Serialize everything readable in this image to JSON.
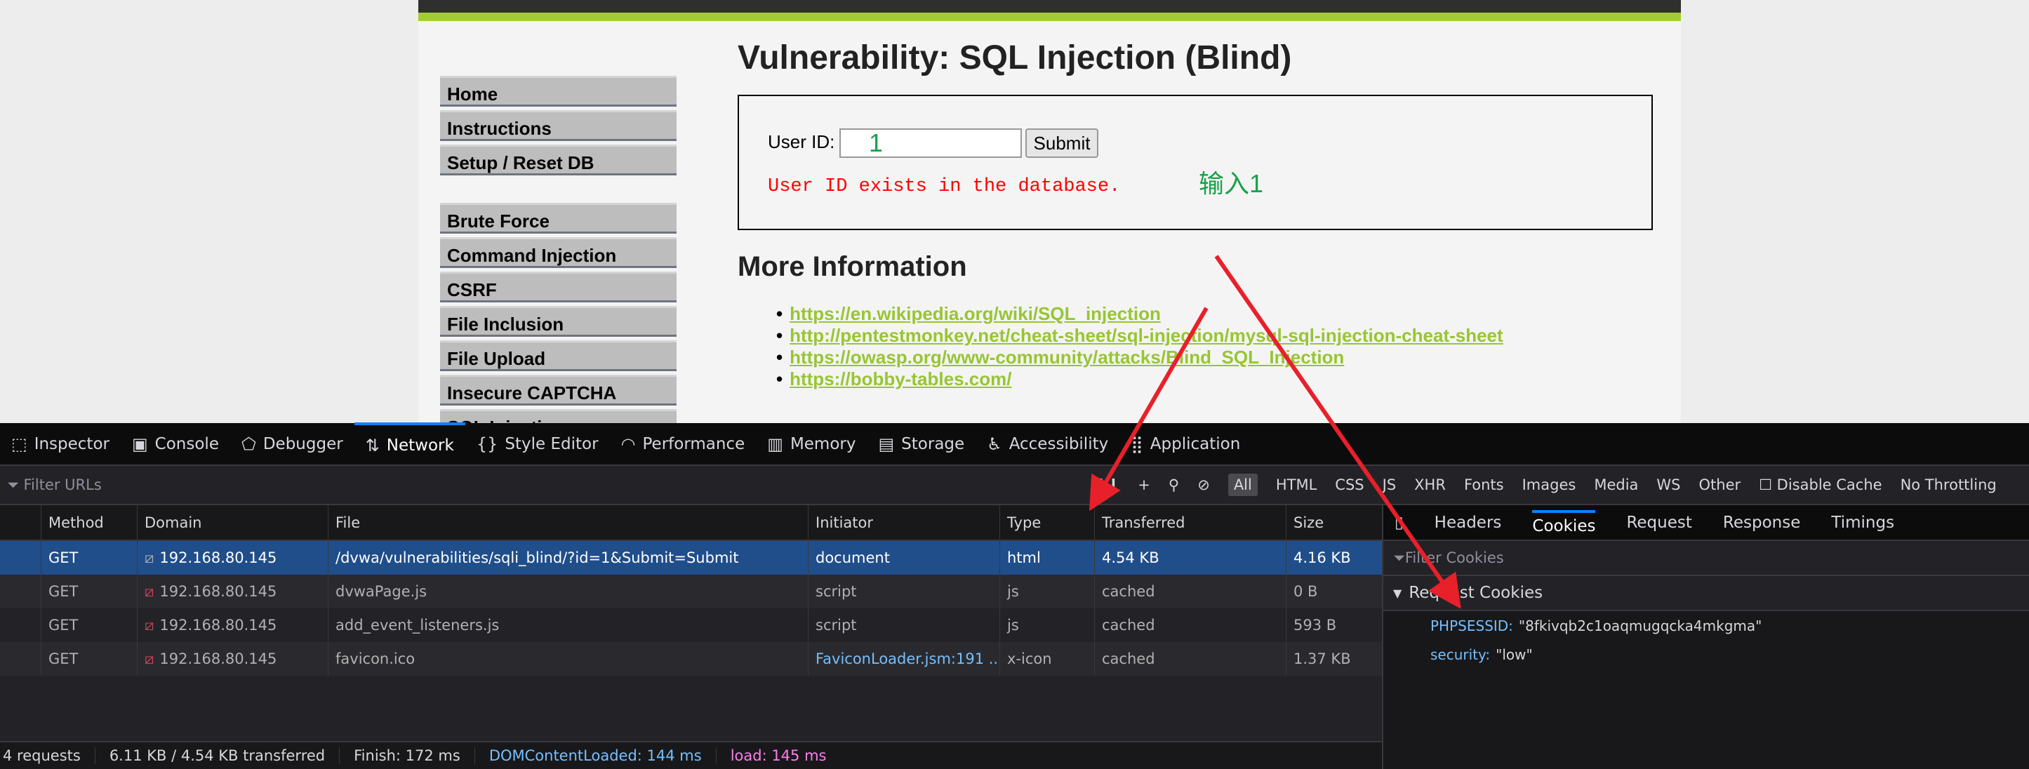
{
  "page": {
    "menu": [
      "Home",
      "Instructions",
      "Setup / Reset DB",
      "Brute Force",
      "Command Injection",
      "CSRF",
      "File Inclusion",
      "File Upload",
      "Insecure CAPTCHA",
      "SQL Injection"
    ],
    "title": "Vulnerability: SQL Injection (Blind)",
    "form": {
      "label": "User ID:",
      "value": "1",
      "submit": "Submit"
    },
    "message": "User ID exists in the database.",
    "annotation": "输入1",
    "more_title": "More Information",
    "links": [
      "https://en.wikipedia.org/wiki/SQL_injection",
      "http://pentestmonkey.net/cheat-sheet/sql-injection/mysql-sql-injection-cheat-sheet",
      "https://owasp.org/www-community/attacks/Blind_SQL_Injection",
      "https://bobby-tables.com/"
    ]
  },
  "devtools": {
    "tabs": [
      "Inspector",
      "Console",
      "Debugger",
      "Network",
      "Style Editor",
      "Performance",
      "Memory",
      "Storage",
      "Accessibility",
      "Application"
    ],
    "filter_placeholder": "Filter URLs",
    "type_filters": [
      "All",
      "HTML",
      "CSS",
      "JS",
      "XHR",
      "Fonts",
      "Images",
      "Media",
      "WS",
      "Other"
    ],
    "disable_cache": "Disable Cache",
    "throttle": "No Throttling",
    "columns": [
      "Method",
      "Domain",
      "File",
      "Initiator",
      "Type",
      "Transferred",
      "Size"
    ],
    "rows": [
      {
        "method": "GET",
        "domain": "192.168.80.145",
        "file": "/dvwa/vulnerabilities/sqli_blind/?id=1&Submit=Submit",
        "initiator": "document",
        "type": "html",
        "transferred": "4.54 KB",
        "size": "4.16 KB"
      },
      {
        "method": "GET",
        "domain": "192.168.80.145",
        "file": "dvwaPage.js",
        "initiator": "script",
        "type": "js",
        "transferred": "cached",
        "size": "0 B"
      },
      {
        "method": "GET",
        "domain": "192.168.80.145",
        "file": "add_event_listeners.js",
        "initiator": "script",
        "type": "js",
        "transferred": "cached",
        "size": "593 B"
      },
      {
        "method": "GET",
        "domain": "192.168.80.145",
        "file": "favicon.ico",
        "initiator": "FaviconLoader.jsm:191 ...",
        "type": "x-icon",
        "transferred": "cached",
        "size": "1.37 KB"
      }
    ],
    "status": {
      "requests": "4 requests",
      "size": "6.11 KB / 4.54 KB transferred",
      "finish": "Finish: 172 ms",
      "dcl": "DOMContentLoaded: 144 ms",
      "load": "load: 145 ms"
    },
    "side_tabs": [
      "Headers",
      "Cookies",
      "Request",
      "Response",
      "Timings"
    ],
    "filter_cookies": "Filter Cookies",
    "request_cookies": "Request Cookies",
    "cookies": [
      {
        "name": "PHPSESSID:",
        "value": "\"8fkivqb2c1oaqmugqcka4mkgma\""
      },
      {
        "name": "security:",
        "value": "\"low\""
      }
    ]
  },
  "colors": {
    "accent": "#0a84ff",
    "selected_row": "#204e8a",
    "link": "#98c533",
    "annotation_arrow": "#e8202a"
  }
}
